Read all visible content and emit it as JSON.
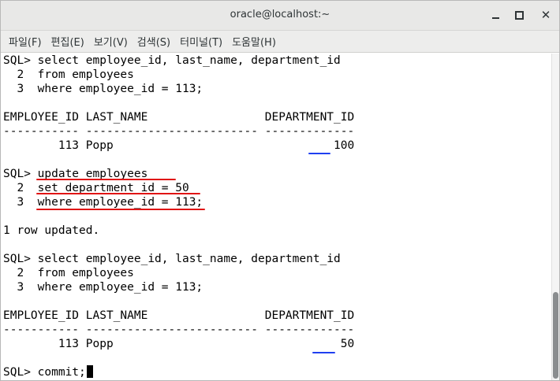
{
  "window": {
    "title": "oracle@localhost:~"
  },
  "menu": {
    "items": [
      "파일(F)",
      "편집(E)",
      "보기(V)",
      "검색(S)",
      "터미널(T)",
      "도움말(H)"
    ]
  },
  "terminal": {
    "lines": [
      "SQL> select employee_id, last_name, department_id",
      "  2  from employees",
      "  3  where employee_id = 113;",
      "",
      "EMPLOYEE_ID LAST_NAME                 DEPARTMENT_ID",
      "----------- ------------------------- -------------",
      "        113 Popp                                100",
      "",
      "SQL> update employees",
      "  2  set department_id = 50",
      "  3  where employee_id = 113;",
      "",
      "1 row updated.",
      "",
      "SQL> select employee_id, last_name, department_id",
      "  2  from employees",
      "  3  where employee_id = 113;",
      "",
      "EMPLOYEE_ID LAST_NAME                 DEPARTMENT_ID",
      "----------- ------------------------- -------------",
      "        113 Popp                                 50",
      "",
      "SQL> commit;"
    ]
  },
  "colors": {
    "annotation_red": "#e01414",
    "annotation_blue": "#1f3ff0"
  },
  "icons": {
    "minimize": "minimize-icon",
    "maximize": "maximize-icon",
    "close": "close-icon"
  }
}
